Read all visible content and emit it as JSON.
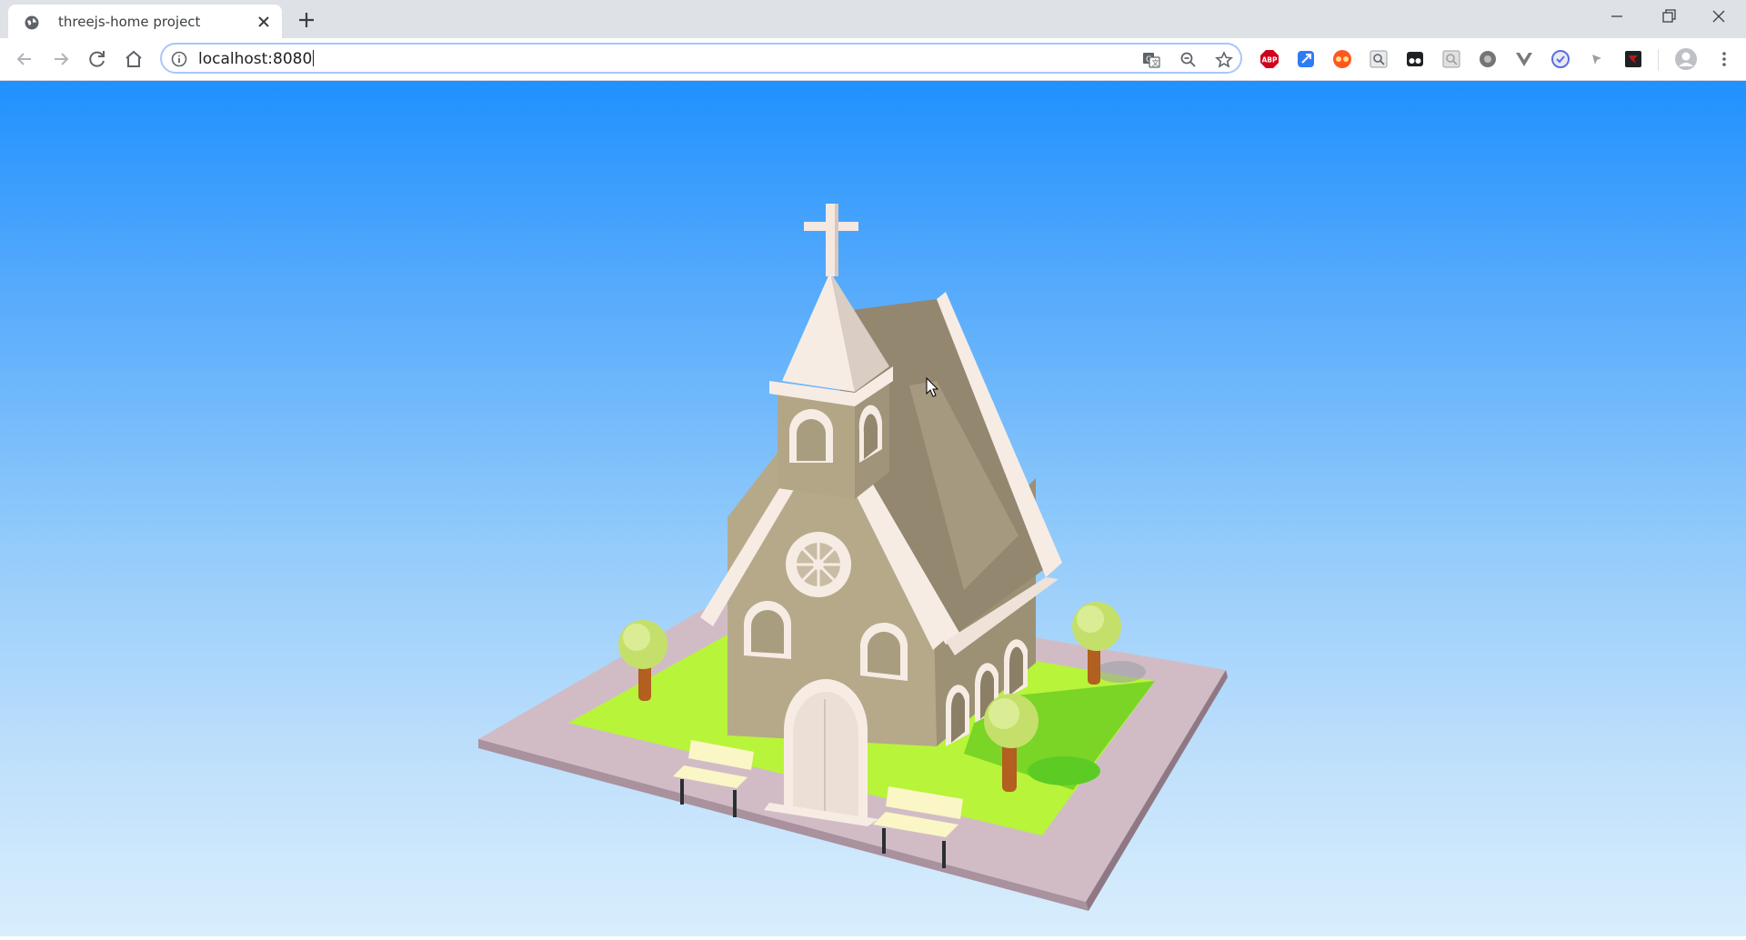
{
  "browser": {
    "tab_title": "threejs-home project",
    "url": "localhost:8080"
  },
  "icons": {
    "tab_favicon": "globe-icon",
    "tab_close": "close-icon",
    "new_tab": "plus-icon",
    "back": "arrow-left-icon",
    "forward": "arrow-right-icon",
    "reload": "reload-icon",
    "home": "home-icon",
    "site_info": "info-icon",
    "translate": "translate-icon",
    "zoom": "zoom-out-icon",
    "bookmark": "star-icon",
    "profile": "avatar-icon",
    "menu": "kebab-menu-icon"
  },
  "extensions": [
    {
      "name": "adblock-extension-icon",
      "label": "ABP",
      "color": "#d0021b"
    },
    {
      "name": "blue-extension-icon",
      "label": "",
      "color": "#2f7cf6"
    },
    {
      "name": "glasses-extension-icon",
      "label": "",
      "color": "#ff5722"
    },
    {
      "name": "search-extension-icon",
      "label": "",
      "color": "#9e9e9e"
    },
    {
      "name": "dark-extension-icon",
      "label": "",
      "color": "#202124"
    },
    {
      "name": "gray-search-extension-icon",
      "label": "",
      "color": "#9e9e9e"
    },
    {
      "name": "circle-extension-icon",
      "label": "",
      "color": "#757575"
    },
    {
      "name": "vue-extension-icon",
      "label": "",
      "color": "#7a7a7a"
    },
    {
      "name": "shield-extension-icon",
      "label": "",
      "color": "#5b6ee1"
    },
    {
      "name": "arrow-extension-icon",
      "label": "",
      "color": "#9e9e9e"
    },
    {
      "name": "red-extension-icon",
      "label": "",
      "color": "#b71c1c"
    }
  ],
  "scene": {
    "background_top": "#2091ff",
    "background_bottom": "#d9eefd",
    "ground_color": "#d1bcc6",
    "grass_color": "#b8f43a",
    "wall_color": "#b6a98a",
    "trim_color": "#f7ece4",
    "tree_trunk": "#b25f1f",
    "tree_crown": "#d6ec86",
    "bench_color": "#fbf6c6"
  }
}
